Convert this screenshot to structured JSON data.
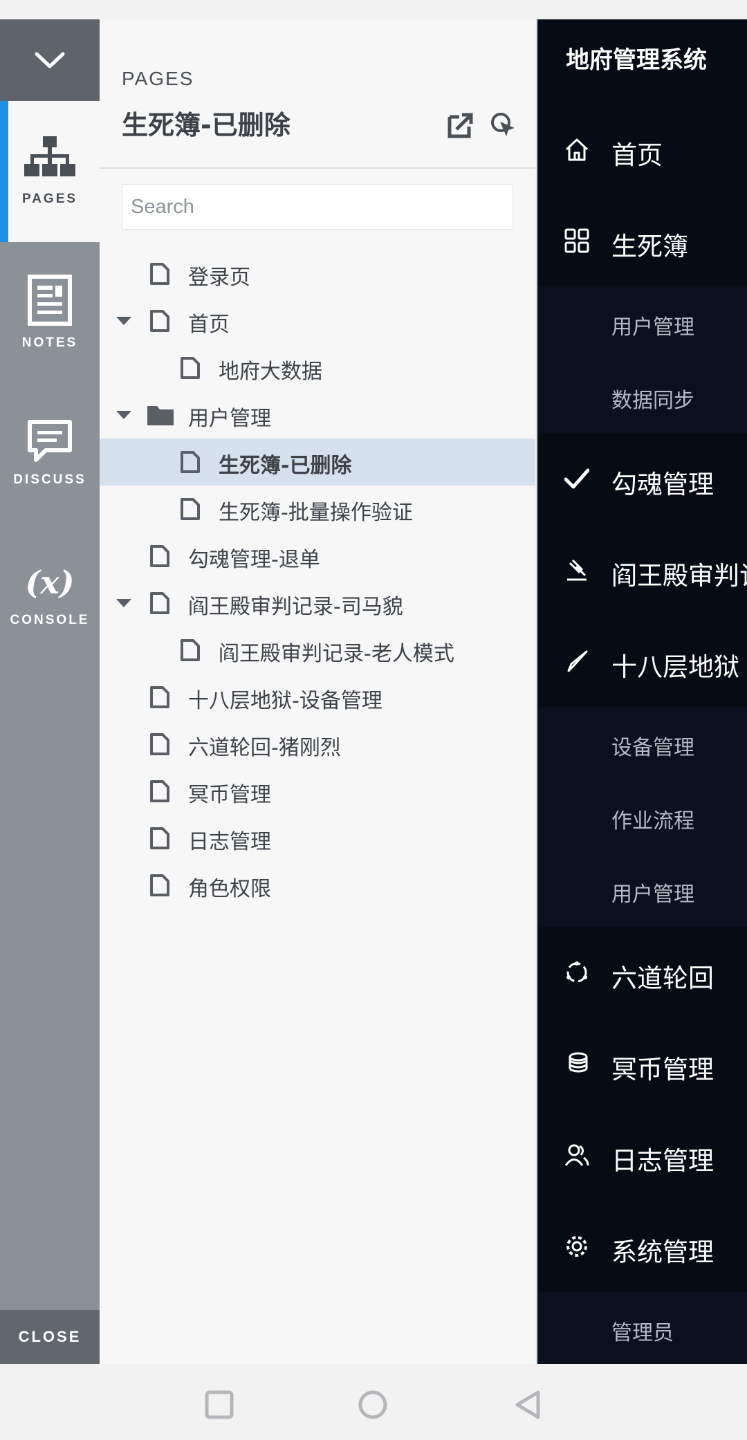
{
  "rail": {
    "items": [
      {
        "label": "PAGES",
        "icon": "sitemap-icon"
      },
      {
        "label": "NOTES",
        "icon": "notes-icon"
      },
      {
        "label": "DISCUSS",
        "icon": "discuss-icon"
      },
      {
        "label": "CONSOLE",
        "icon": "variable-icon"
      }
    ],
    "close_label": "CLOSE"
  },
  "pages": {
    "kicker": "PAGES",
    "title": "生死簿-已删除",
    "search_placeholder": "Search",
    "tree": [
      {
        "label": "登录页",
        "type": "page",
        "level": 0,
        "expanded": false
      },
      {
        "label": "首页",
        "type": "page",
        "level": 0,
        "expanded": true
      },
      {
        "label": "地府大数据",
        "type": "page",
        "level": 1
      },
      {
        "label": "用户管理",
        "type": "folder",
        "level": 0,
        "expanded": true
      },
      {
        "label": "生死簿-已删除",
        "type": "page",
        "level": 1,
        "selected": true
      },
      {
        "label": "生死簿-批量操作验证",
        "type": "page",
        "level": 1
      },
      {
        "label": "勾魂管理-退单",
        "type": "page",
        "level": 0
      },
      {
        "label": "阎王殿审判记录-司马貌",
        "type": "page",
        "level": 0,
        "expanded": true
      },
      {
        "label": "阎王殿审判记录-老人模式",
        "type": "page",
        "level": 1
      },
      {
        "label": "十八层地狱-设备管理",
        "type": "page",
        "level": 0
      },
      {
        "label": "六道轮回-猪刚烈",
        "type": "page",
        "level": 0
      },
      {
        "label": "冥币管理",
        "type": "page",
        "level": 0
      },
      {
        "label": "日志管理",
        "type": "page",
        "level": 0
      },
      {
        "label": "角色权限",
        "type": "page",
        "level": 0
      }
    ]
  },
  "nav": {
    "title": "地府管理系统",
    "items": [
      {
        "kind": "main",
        "label": "首页",
        "icon": "home-icon"
      },
      {
        "kind": "main",
        "label": "生死簿",
        "icon": "grid-icon"
      },
      {
        "kind": "sub",
        "label": "用户管理"
      },
      {
        "kind": "sub",
        "label": "数据同步"
      },
      {
        "kind": "main",
        "label": "勾魂管理",
        "icon": "check-icon"
      },
      {
        "kind": "main",
        "label": "阎王殿审判记录",
        "icon": "gavel-icon"
      },
      {
        "kind": "main",
        "label": "十八层地狱",
        "icon": "knife-icon"
      },
      {
        "kind": "sub",
        "label": "设备管理"
      },
      {
        "kind": "sub",
        "label": "作业流程"
      },
      {
        "kind": "sub",
        "label": "用户管理"
      },
      {
        "kind": "main",
        "label": "六道轮回",
        "icon": "cycle-icon"
      },
      {
        "kind": "main",
        "label": "冥币管理",
        "icon": "coins-icon"
      },
      {
        "kind": "main",
        "label": "日志管理",
        "icon": "users-icon"
      },
      {
        "kind": "main",
        "label": "系统管理",
        "icon": "gear-icon"
      },
      {
        "kind": "sub",
        "label": "管理员"
      }
    ]
  },
  "colors": {
    "rail_bg": "#8c9097",
    "rail_active_accent": "#1e90e8",
    "nav_bg": "#0a101d",
    "selected_row": "#d6e1ee"
  }
}
